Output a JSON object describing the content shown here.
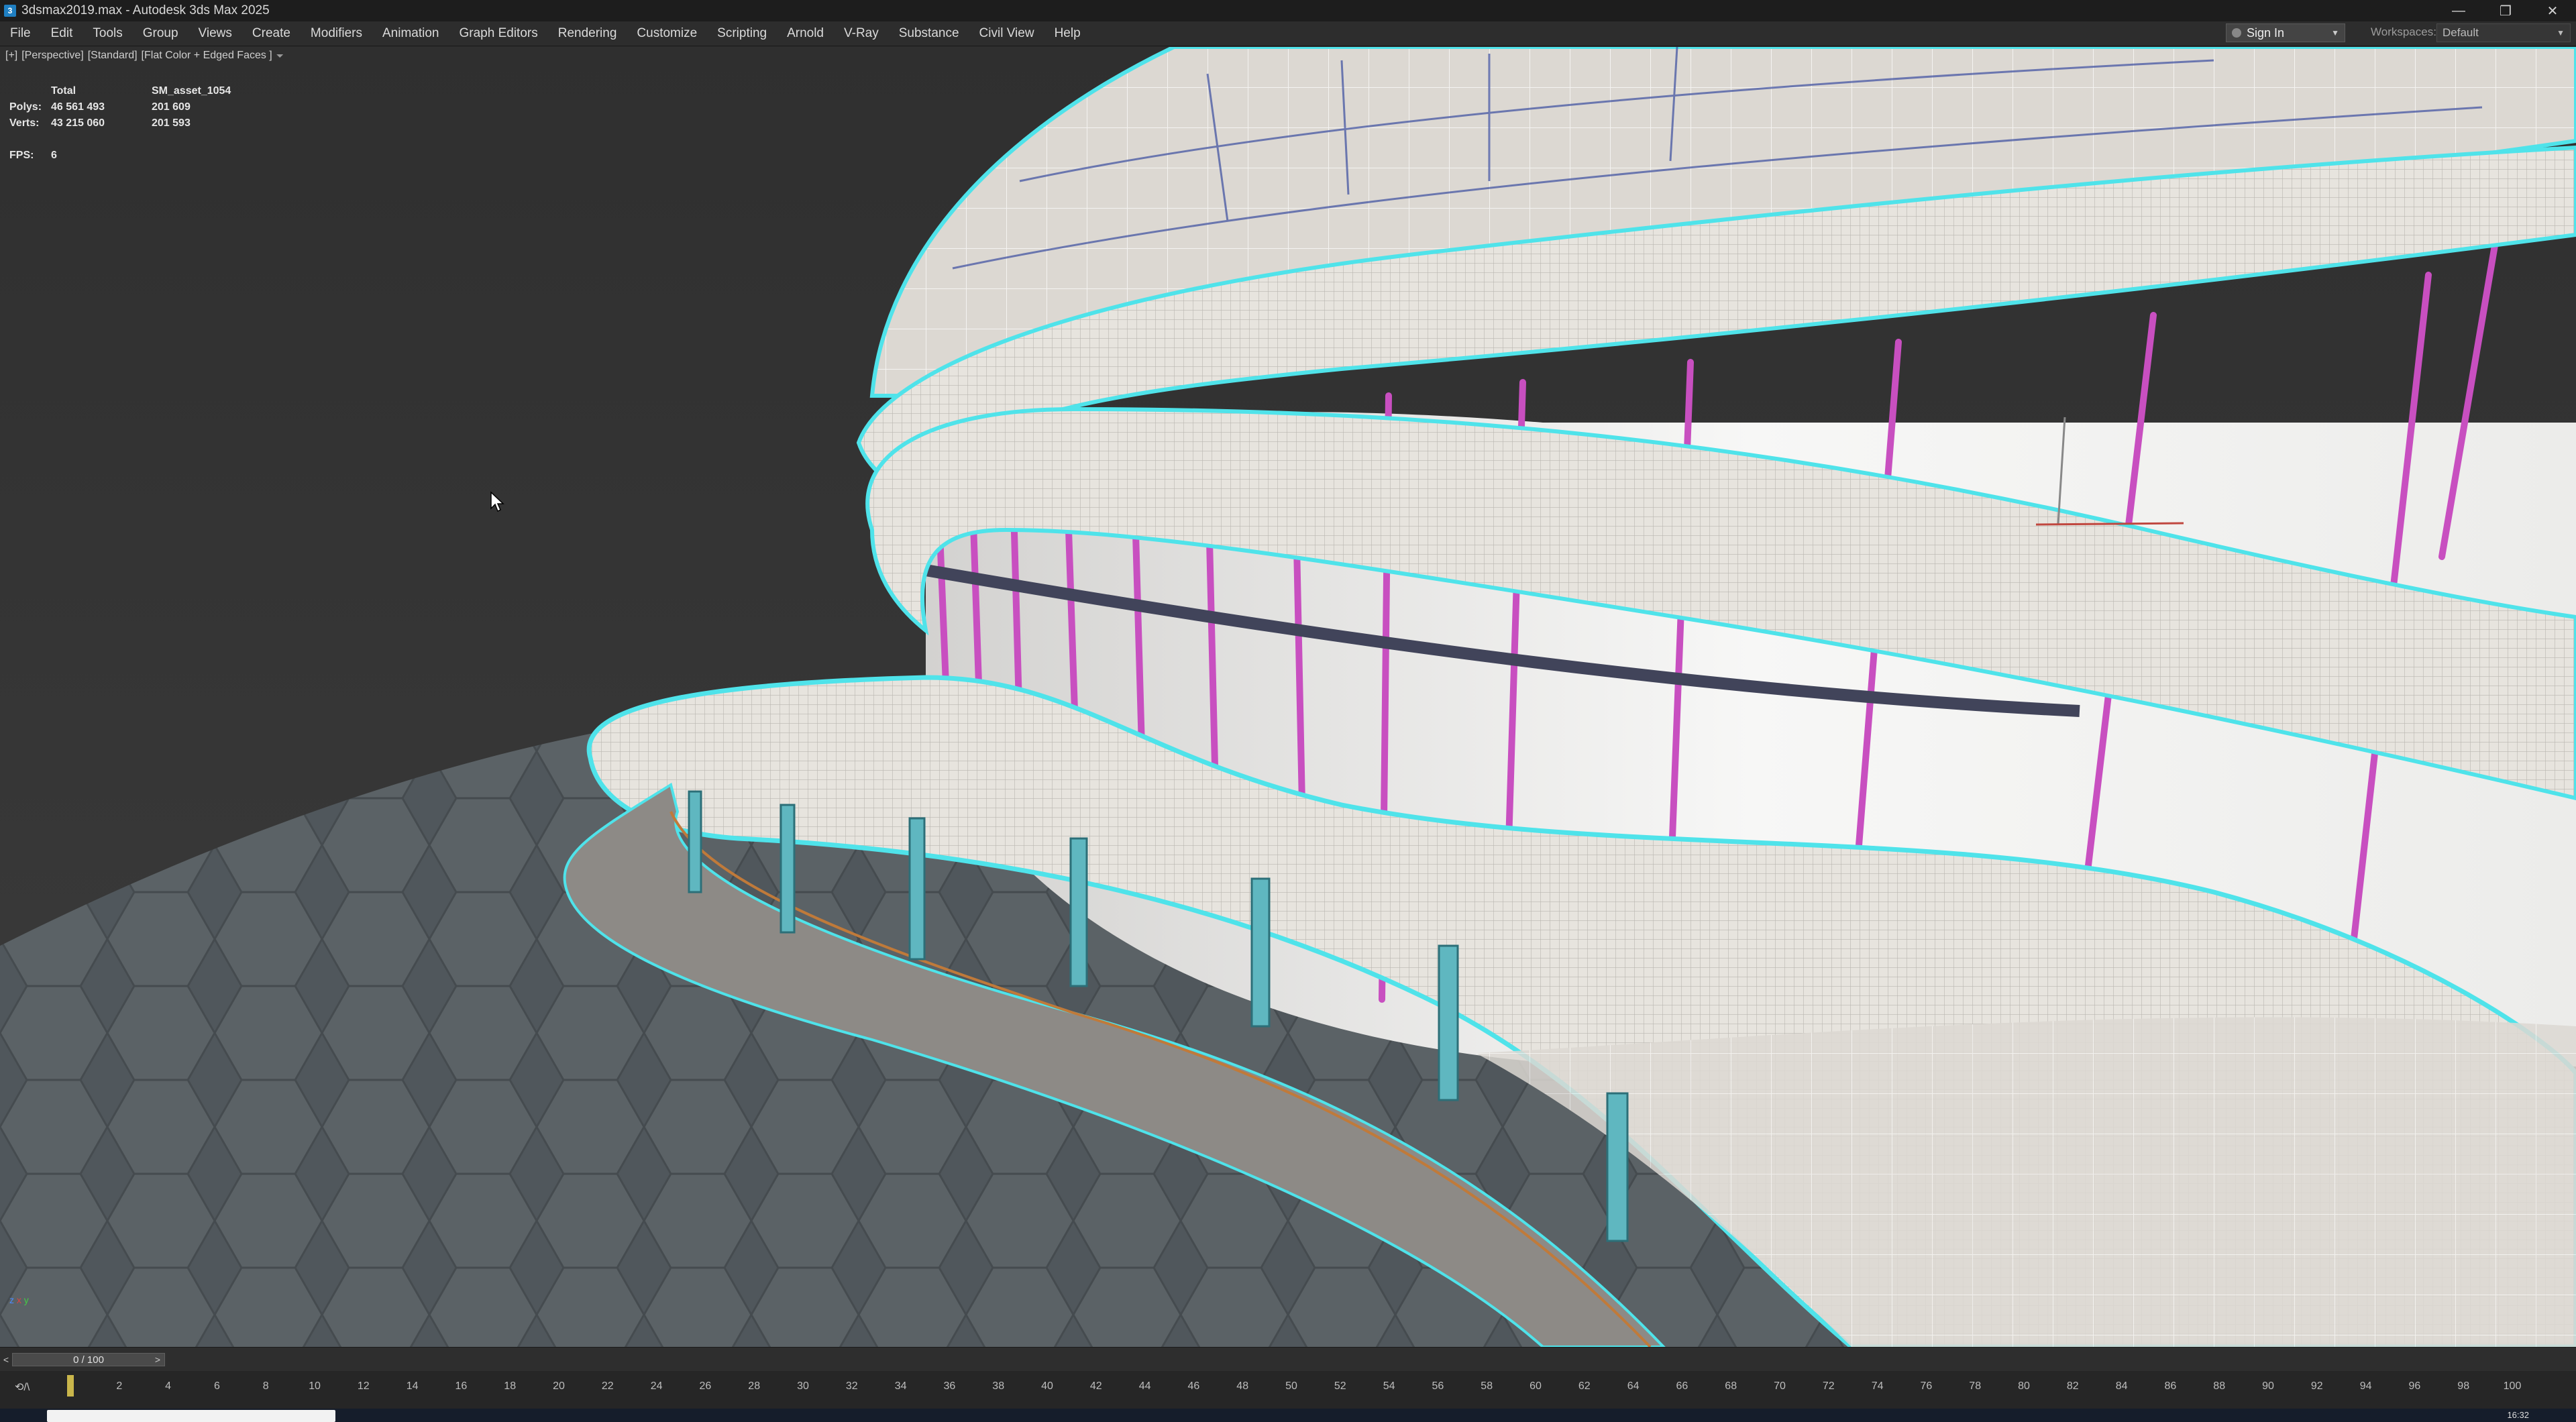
{
  "window": {
    "title": "3dsmax2019.max - Autodesk 3ds Max 2025",
    "app_icon_glyph": "3",
    "controls": {
      "minimize": "—",
      "restore": "❐",
      "close": "✕"
    }
  },
  "menu": [
    "File",
    "Edit",
    "Tools",
    "Group",
    "Views",
    "Create",
    "Modifiers",
    "Animation",
    "Graph Editors",
    "Rendering",
    "Customize",
    "Scripting",
    "Arnold",
    "V-Ray",
    "Substance",
    "Civil View",
    "Help"
  ],
  "signin": {
    "label": "Sign In",
    "chevron": "▼"
  },
  "workspaces": {
    "label": "Workspaces:",
    "value": "Default",
    "chevron": "▼"
  },
  "viewport": {
    "labels": [
      "[+]",
      "[Perspective]",
      "[Standard]",
      "[Flat Color + Edged Faces ]"
    ],
    "filter_icon": "filter-icon",
    "stats": {
      "header": {
        "total": "Total",
        "asset": "SM_asset_1054"
      },
      "polys": {
        "label": "Polys:",
        "total": "46 561 493",
        "asset": "201 609"
      },
      "verts": {
        "label": "Verts:",
        "total": "43 215 060",
        "asset": "201 593"
      },
      "fps": {
        "label": "FPS:",
        "value": "6"
      }
    },
    "gizmo": {
      "z": "z",
      "x": "x",
      "y": "y"
    }
  },
  "timeline": {
    "frame_display": "0 / 100",
    "prev": "<",
    "next": ">"
  },
  "trackbar": {
    "left_icon": "⟲/\\",
    "ticks": [
      "2",
      "4",
      "6",
      "8",
      "10",
      "12",
      "14",
      "16",
      "18",
      "20",
      "22",
      "24",
      "26",
      "28",
      "30",
      "32",
      "34",
      "36",
      "38",
      "40",
      "42",
      "44",
      "46",
      "48",
      "50",
      "52",
      "54",
      "56",
      "58",
      "60",
      "62",
      "64",
      "66",
      "68",
      "70",
      "72",
      "74",
      "76",
      "78",
      "80",
      "82",
      "84",
      "86",
      "88",
      "90",
      "92",
      "94",
      "96",
      "98",
      "100"
    ]
  },
  "taskbar": {
    "clock": "16:32"
  },
  "colors": {
    "accent_cyan": "#4fe3ea",
    "mullion_magenta": "#c84fc0",
    "slab_white": "#e9e6e0",
    "ground": "#545a5e",
    "column_teal": "#5fb7c0"
  }
}
